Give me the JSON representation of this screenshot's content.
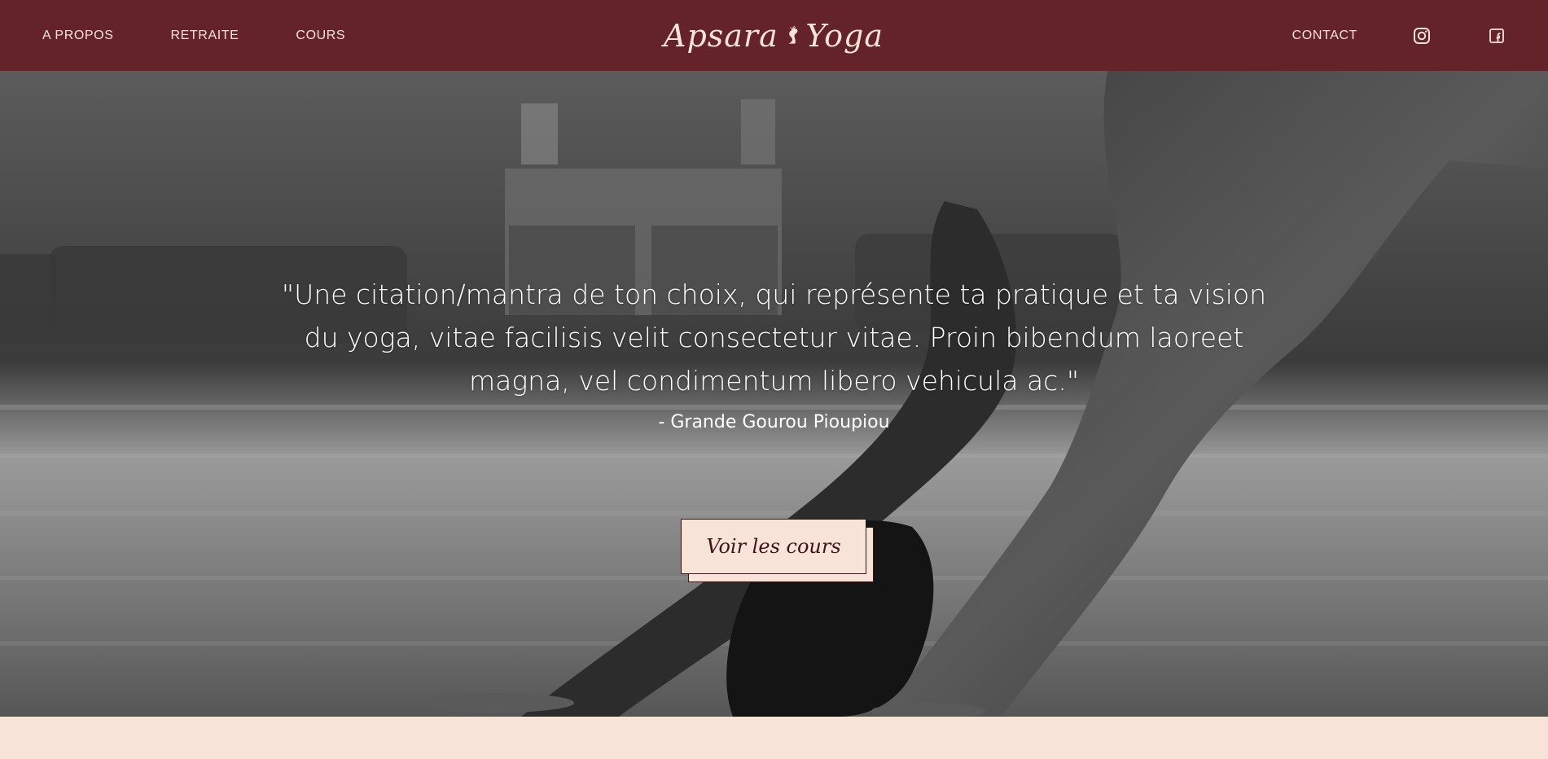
{
  "header": {
    "nav_left": [
      {
        "label": "A PROPOS"
      },
      {
        "label": "RETRAITE"
      },
      {
        "label": "COURS"
      }
    ],
    "logo": {
      "word1": "Apsara",
      "word2": "Yoga"
    },
    "nav_right": {
      "contact_label": "CONTACT"
    },
    "social": {
      "instagram_icon": "instagram-icon",
      "facebook_icon": "facebook-icon"
    }
  },
  "hero": {
    "quote": "\"Une citation/mantra de ton choix, qui représente ta pratique et ta vision du yoga, vitae facilisis velit consectetur vitae. Proin bibendum laoreet magna, vel condimentum libero vehicula ac.\"",
    "author": "- Grande Gourou Pioupiou",
    "cta_label": "Voir les cours",
    "image": "black-and-white photo of a woman in downward dog yoga pose"
  },
  "colors": {
    "header_bg": "#632328",
    "accent_light": "#f8e3d8",
    "text_dark": "#3a1518"
  }
}
